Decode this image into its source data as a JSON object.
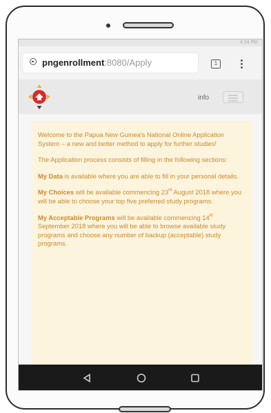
{
  "statusbar": {
    "time": "4:24 PM"
  },
  "browser": {
    "url_host": "pngenrollment",
    "url_path": ":8080/Apply",
    "tabs_count": "1"
  },
  "site": {
    "info_label": "info"
  },
  "content": {
    "intro": "Welcome to the Papua New Guinea's National Online Application System – a new and better method to apply for further studies!",
    "process": "The Application process consists of filling in the following sections:",
    "my_data_title": "My Data",
    "my_data_text": " is available where you are able to fill in your personal details.",
    "my_choices_title": "My Choices",
    "my_choices_pre": " will be available commencing 23",
    "my_choices_sup": "rd",
    "my_choices_post": " August 2018 where you will be able to choose your top five preferred study programs.",
    "my_acceptable_title": "My Acceptable Programs",
    "my_acceptable_pre": " will be available commencing 14",
    "my_acceptable_sup": "th",
    "my_acceptable_post": " September 2018 where you will be able to browse available study programs and choose any number of backup (acceptable) study programs."
  },
  "colors": {
    "accent_text": "#c88a2e",
    "content_bg": "#fcf4dd",
    "logo_red": "#d92a2a",
    "logo_gold": "#f0b323"
  },
  "icons": {
    "nav": [
      "back-triangle-icon",
      "home-circle-icon",
      "recents-square-icon"
    ]
  }
}
